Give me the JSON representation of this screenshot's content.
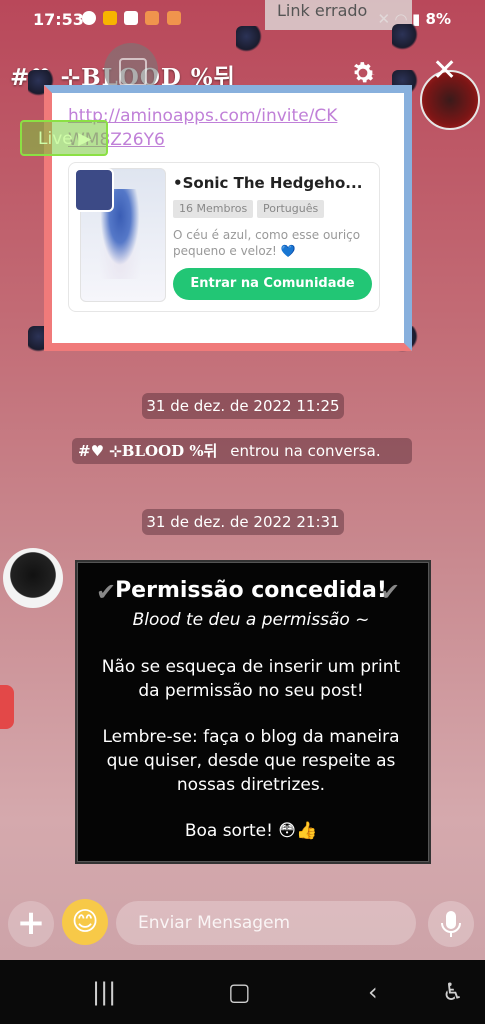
{
  "status_bar": {
    "time": "17:53",
    "battery": "8%"
  },
  "toast": {
    "link_error": "Link errado"
  },
  "header": {
    "title": "#♥  ⊹BLOOD  %뒤"
  },
  "invite": {
    "link_text": "http://aminoapps.com/invite/CKWM8Z26Y6",
    "live_label": "Live",
    "card": {
      "title": "•Sonic The Hedgeho...",
      "tags": [
        "16 Membros",
        "Português"
      ],
      "description": "O céu é azul, como esse ouriço pequeno e veloz! 💙",
      "join_label": "Entrar na Comunidade"
    }
  },
  "chat": {
    "timestamp1": "31 de dez. de 2022 11:25",
    "join_name": "#♥  ⊹BLOOD  %뒤",
    "join_text": "entrou na conversa.",
    "timestamp2": "31 de dez. de 2022 21:31",
    "message": {
      "title": "Permissão concedida!",
      "subtitle": "Blood te deu a permissão ~",
      "para1": "Não se esqueça de inserir um print da permissão no seu post!",
      "para2": "Lembre-se: faça o blog da maneira que quiser, desde que respeite as nossas diretrizes.",
      "para3": "Boa sorte! 😳👍"
    }
  },
  "input": {
    "placeholder": "Enviar Mensagem"
  },
  "colors": {
    "join_button": "#22c675",
    "invite_link": "#c080d8",
    "side_menu": "#e34848"
  }
}
